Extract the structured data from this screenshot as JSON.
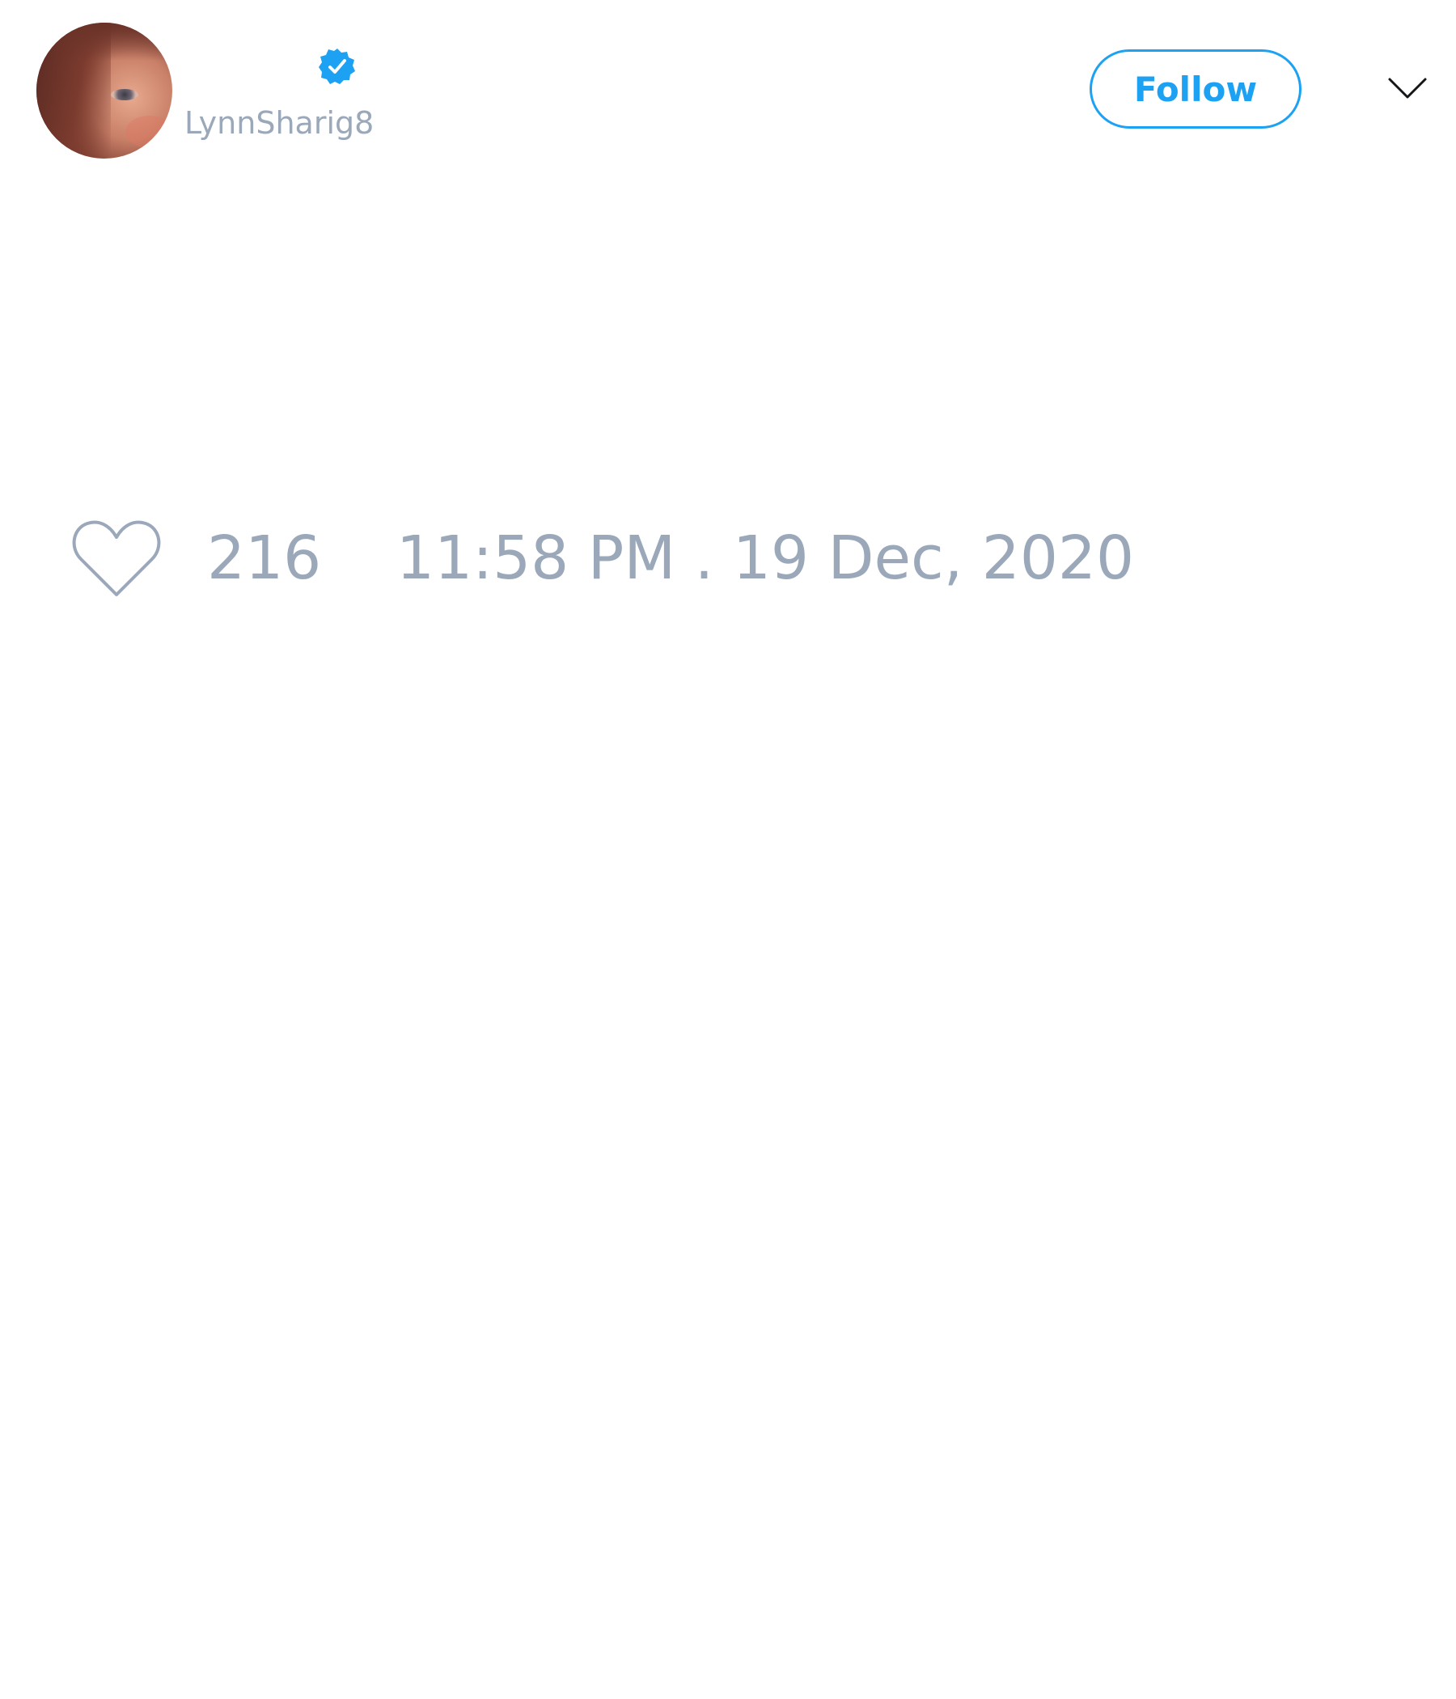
{
  "tweet": {
    "author": {
      "display_name": "",
      "username": "LynnSharig8",
      "verified": true,
      "avatar_icon": "user-avatar-photo"
    },
    "actions": {
      "follow_label": "Follow",
      "menu_icon": "chevron-down-icon"
    },
    "stats": {
      "like_icon": "heart-outline-icon",
      "like_count": "216",
      "timestamp": "11:58 PM . 19 Dec, 2020"
    }
  },
  "colors": {
    "accent": "#1da1f2",
    "muted_text": "#9aa8ba",
    "background": "#ffffff",
    "icon_dark": "#14171a"
  }
}
